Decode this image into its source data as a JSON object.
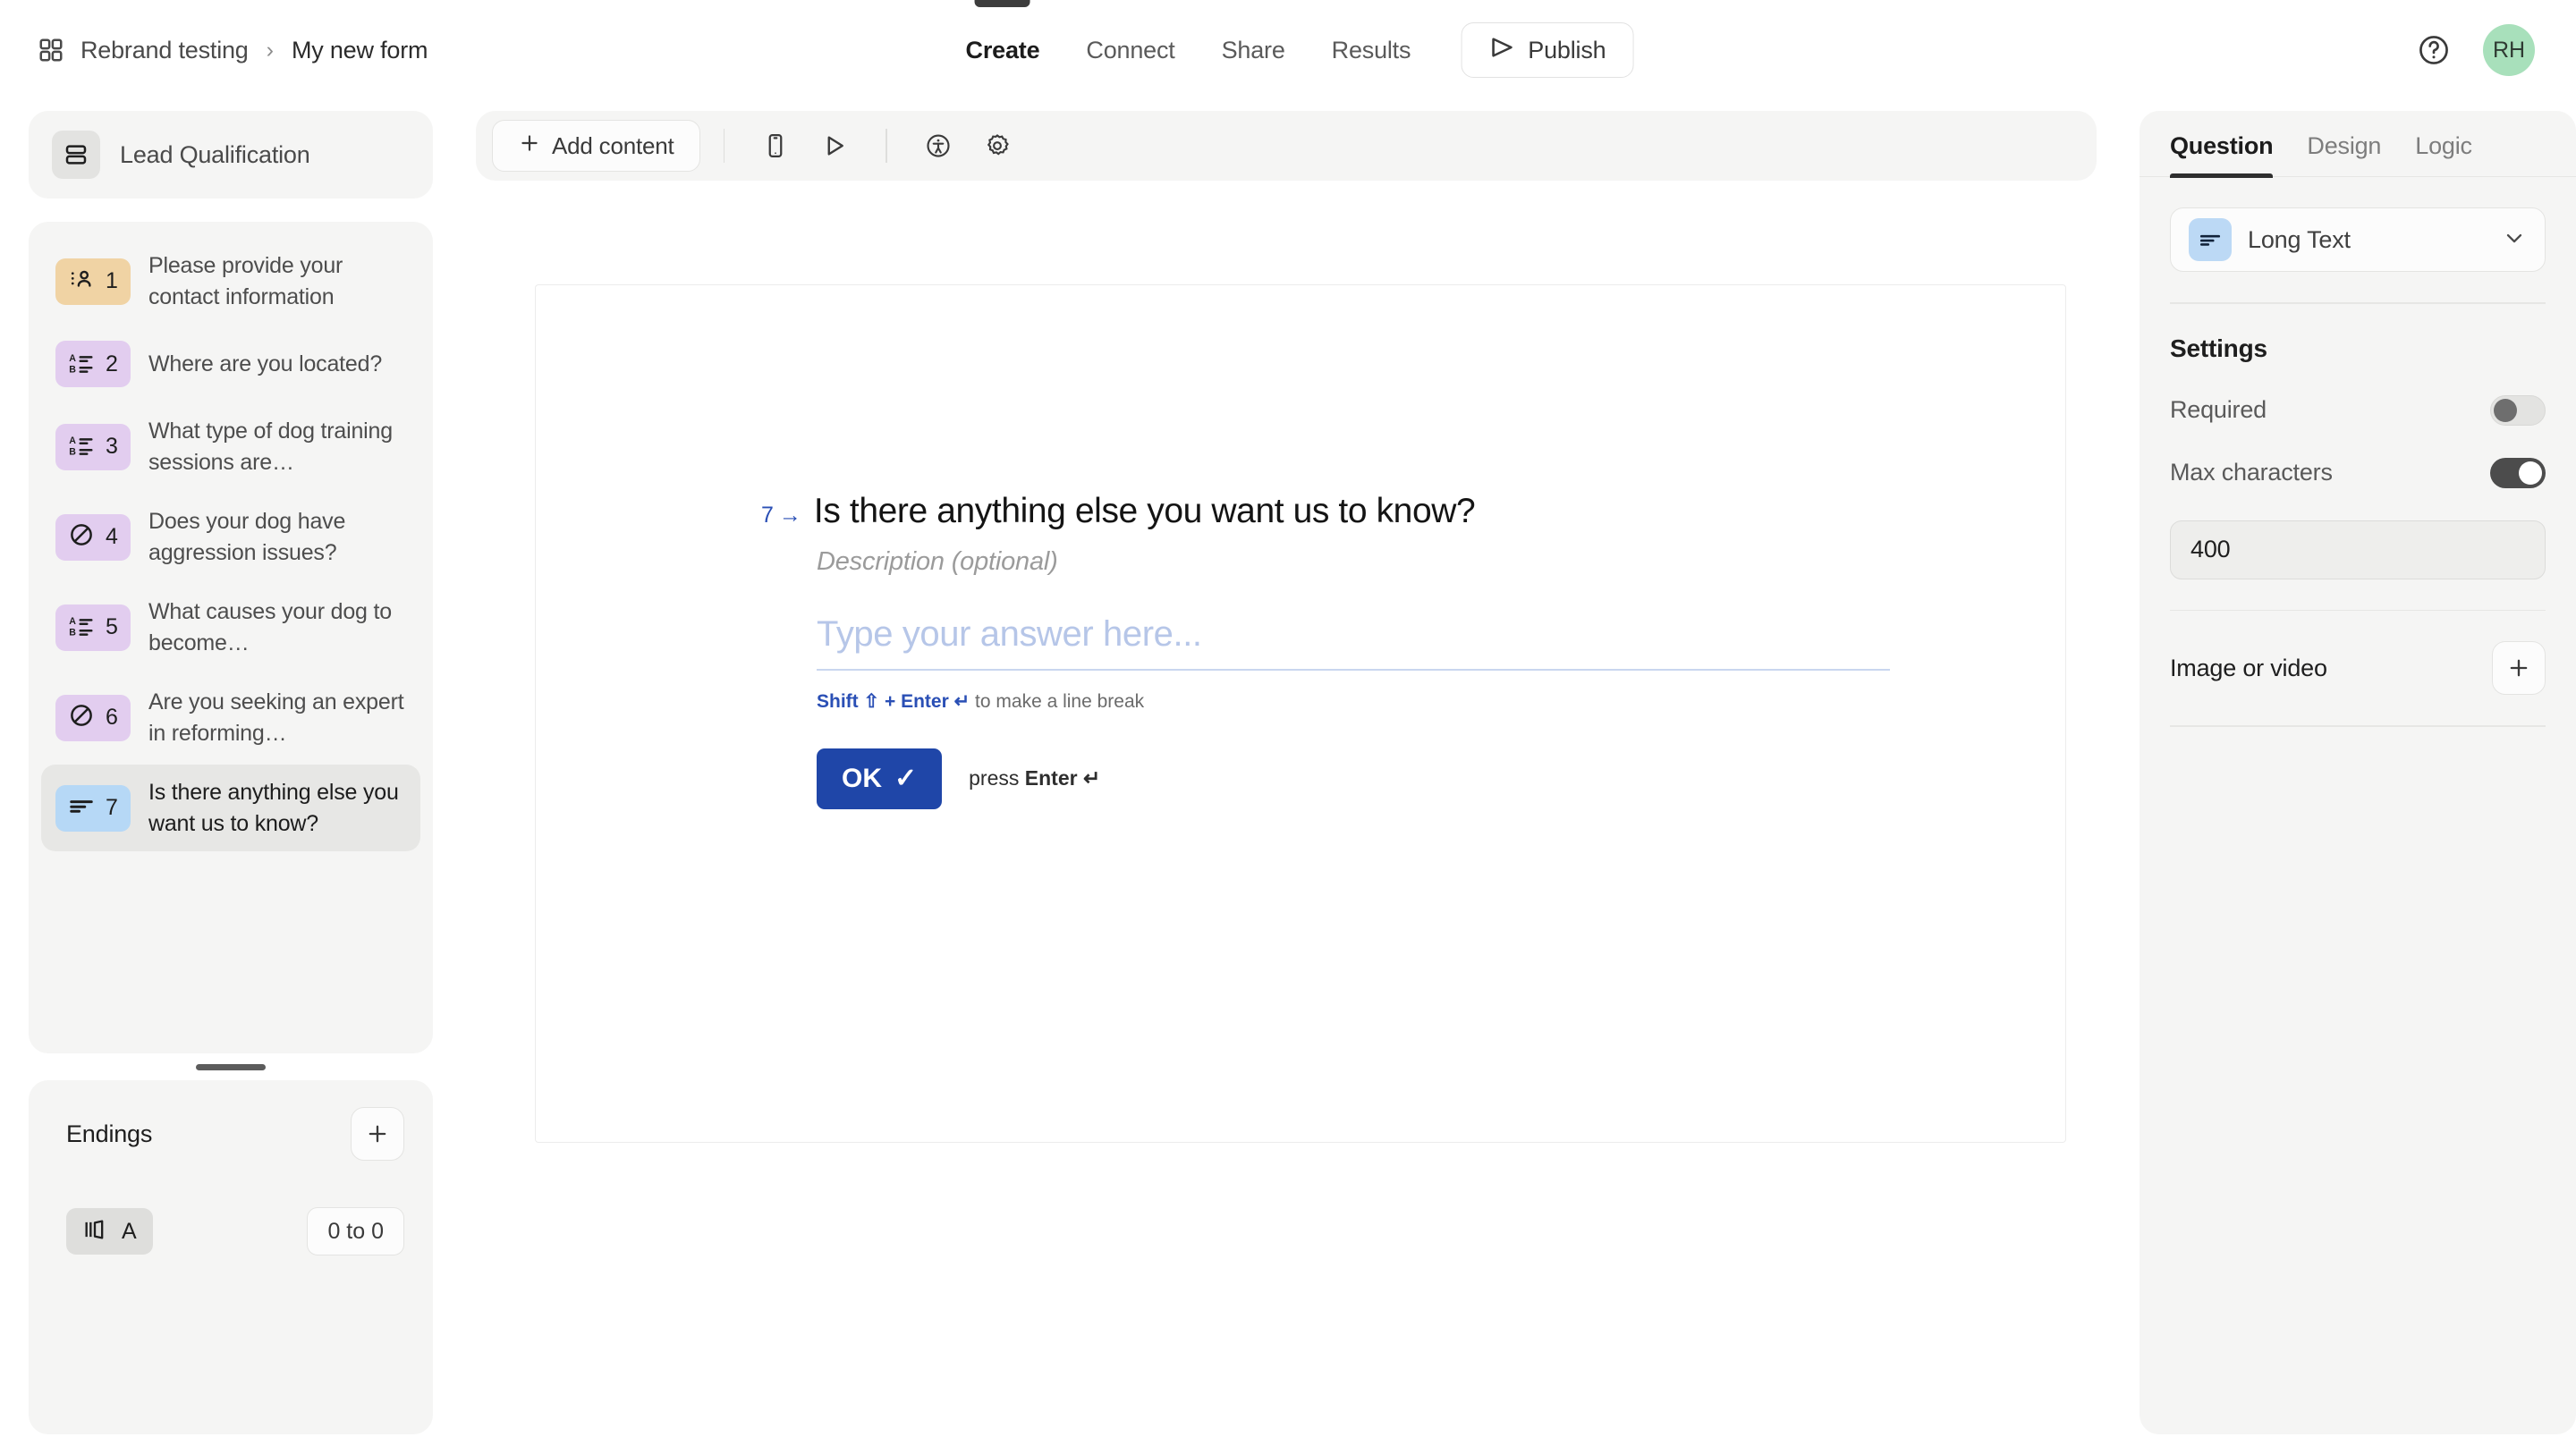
{
  "header": {
    "workspace": "Rebrand testing",
    "separator": "›",
    "form_title": "My new form",
    "nav_tabs": [
      {
        "label": "Create",
        "active": true
      },
      {
        "label": "Connect",
        "active": false
      },
      {
        "label": "Share",
        "active": false
      },
      {
        "label": "Results",
        "active": false
      }
    ],
    "publish_label": "Publish",
    "avatar_initials": "RH"
  },
  "sidebar": {
    "form_name": "Lead Qualification",
    "questions": [
      {
        "number": "1",
        "text": "Please provide your contact information",
        "icon": "contact-info-icon",
        "badge_color": "#f0d3a4",
        "selected": false
      },
      {
        "number": "2",
        "text": "Where are you located?",
        "icon": "multiple-choice-icon",
        "badge_color": "#e2cdef",
        "selected": false
      },
      {
        "number": "3",
        "text": "What type of dog training sessions are…",
        "icon": "multiple-choice-icon",
        "badge_color": "#e2cdef",
        "selected": false
      },
      {
        "number": "4",
        "text": "Does your dog have aggression issues?",
        "icon": "yes-no-icon",
        "badge_color": "#e2cdef",
        "selected": false
      },
      {
        "number": "5",
        "text": "What causes your dog to become…",
        "icon": "multiple-choice-icon",
        "badge_color": "#e2cdef",
        "selected": false
      },
      {
        "number": "6",
        "text": "Are you seeking an expert in reforming…",
        "icon": "yes-no-icon",
        "badge_color": "#e2cdef",
        "selected": false
      },
      {
        "number": "7",
        "text": "Is there anything else you want us to know?",
        "icon": "long-text-icon",
        "badge_color": "#b6d8f6",
        "selected": true
      }
    ],
    "endings": {
      "title": "Endings",
      "add_label": "+",
      "items": [
        {
          "label": "A",
          "icon": "ending-screen-icon",
          "range": "0 to 0"
        }
      ]
    }
  },
  "toolbar": {
    "add_content_label": "Add content",
    "icons": [
      {
        "name": "mobile-preview-icon"
      },
      {
        "name": "preview-play-icon"
      },
      {
        "name": "accessibility-icon"
      },
      {
        "name": "settings-gear-icon"
      }
    ]
  },
  "canvas": {
    "question_index": "7",
    "question_arrow": "→",
    "question_title": "Is there anything else you want us to know?",
    "description_placeholder": "Description (optional)",
    "answer_placeholder": "Type your answer here...",
    "hint_shift": "Shift",
    "hint_shift_glyph": "⇧",
    "hint_plus": "+",
    "hint_enter": "Enter",
    "hint_enter_glyph": "↵",
    "hint_rest": "to make a line break",
    "ok_label": "OK",
    "ok_check": "✓",
    "press_prefix": "press",
    "press_enter": "Enter",
    "press_glyph": "↵"
  },
  "right_panel": {
    "tabs": [
      {
        "label": "Question",
        "active": true
      },
      {
        "label": "Design",
        "active": false
      },
      {
        "label": "Logic",
        "active": false
      }
    ],
    "question_type": "Long Text",
    "settings_title": "Settings",
    "required_label": "Required",
    "required_on": false,
    "max_characters_label": "Max characters",
    "max_characters_on": true,
    "max_characters_value": "400",
    "media_label": "Image or video",
    "media_add_label": "+"
  },
  "colors": {
    "accent_blue": "#1f46a8",
    "index_blue": "#2a4fb5",
    "panel_bg": "#f5f5f4",
    "avatar_green": "#a8e0bb"
  }
}
